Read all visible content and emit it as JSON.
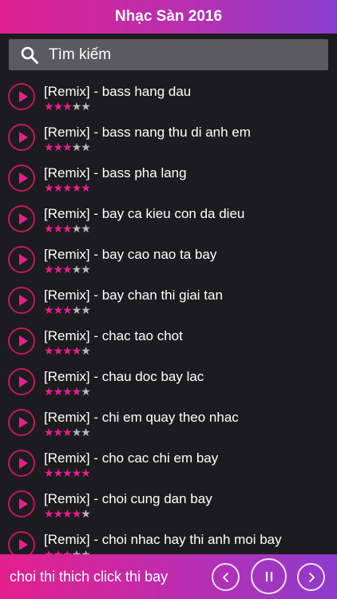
{
  "header": {
    "title": "Nhạc Sàn 2016"
  },
  "search": {
    "placeholder": "Tìm kiếm"
  },
  "songs": [
    {
      "title": "[Remix] - bass hang dau",
      "rating": 3
    },
    {
      "title": "[Remix] - bass nang thu di anh em",
      "rating": 3
    },
    {
      "title": "[Remix] - bass pha lang",
      "rating": 5
    },
    {
      "title": "[Remix] - bay ca kieu con da dieu",
      "rating": 3
    },
    {
      "title": "[Remix] - bay cao nao ta bay",
      "rating": 3
    },
    {
      "title": "[Remix] - bay chan thi giai tan",
      "rating": 3
    },
    {
      "title": "[Remix] - chac tao chot",
      "rating": 4
    },
    {
      "title": "[Remix] - chau doc bay lac",
      "rating": 4
    },
    {
      "title": "[Remix] - chi em quay theo nhac",
      "rating": 3
    },
    {
      "title": "[Remix] - cho cac chi em bay",
      "rating": 5
    },
    {
      "title": "[Remix] - choi cung dan bay",
      "rating": 4
    },
    {
      "title": "[Remix] - choi nhac hay thi anh moi bay",
      "rating": 3
    }
  ],
  "rating_max": 5,
  "player": {
    "now_playing": "choi thi thich click thi bay"
  },
  "colors": {
    "accent": "#e91e8c",
    "accent_end": "#8a3fcf",
    "background": "#1c1c1e",
    "search_bg": "#5b5b5e"
  },
  "icons": {
    "search": "search-icon",
    "play": "play-icon",
    "prev": "chevron-left-icon",
    "pause": "pause-icon",
    "next": "chevron-right-icon"
  }
}
